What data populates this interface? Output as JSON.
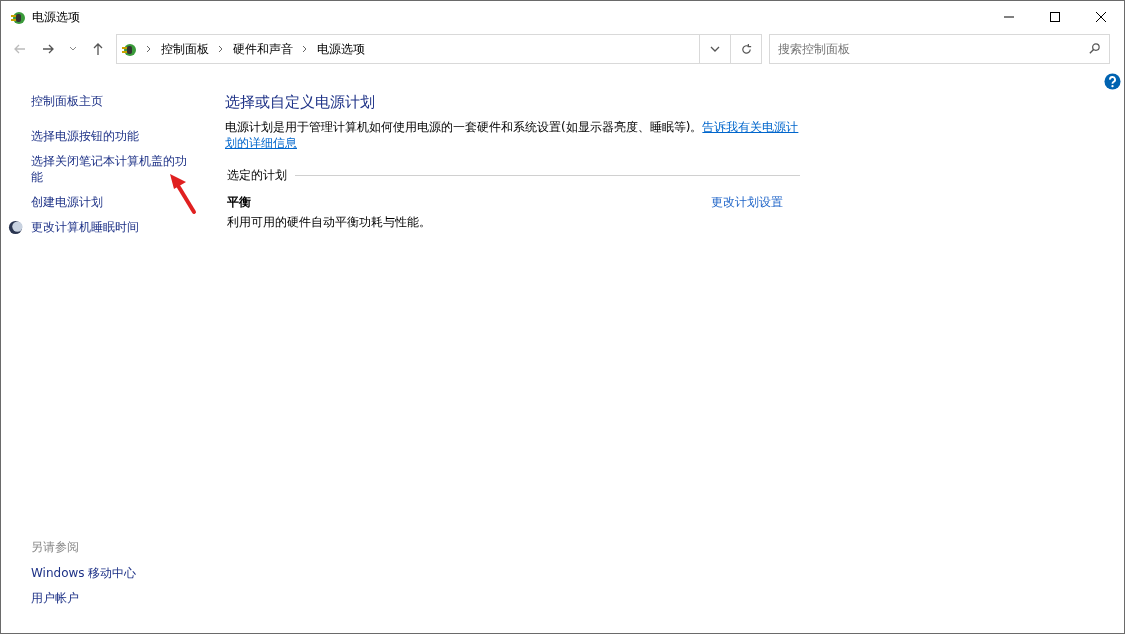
{
  "window": {
    "title": "电源选项"
  },
  "breadcrumb": [
    "控制面板",
    "硬件和声音",
    "电源选项"
  ],
  "search": {
    "placeholder": "搜索控制面板"
  },
  "sidebar": {
    "home": "控制面板主页",
    "items": [
      {
        "label": "选择电源按钮的功能",
        "kind": "link"
      },
      {
        "label": "选择关闭笔记本计算机盖的功能",
        "kind": "link"
      },
      {
        "label": "创建电源计划",
        "kind": "link"
      },
      {
        "label": "更改计算机睡眠时间",
        "kind": "moon-link"
      }
    ],
    "see_also": {
      "heading": "另请参阅",
      "links": [
        "Windows 移动中心",
        "用户帐户"
      ]
    }
  },
  "main": {
    "heading": "选择或自定义电源计划",
    "description": "电源计划是用于管理计算机如何使用电源的一套硬件和系统设置(如显示器亮度、睡眠等)。",
    "learn_more": [
      "告诉我有关电源计",
      "划的详细信息"
    ],
    "section_label": "选定的计划",
    "plans": [
      {
        "name": "平衡",
        "description": "利用可用的硬件自动平衡功耗与性能。",
        "action": "更改计划设置"
      }
    ]
  }
}
